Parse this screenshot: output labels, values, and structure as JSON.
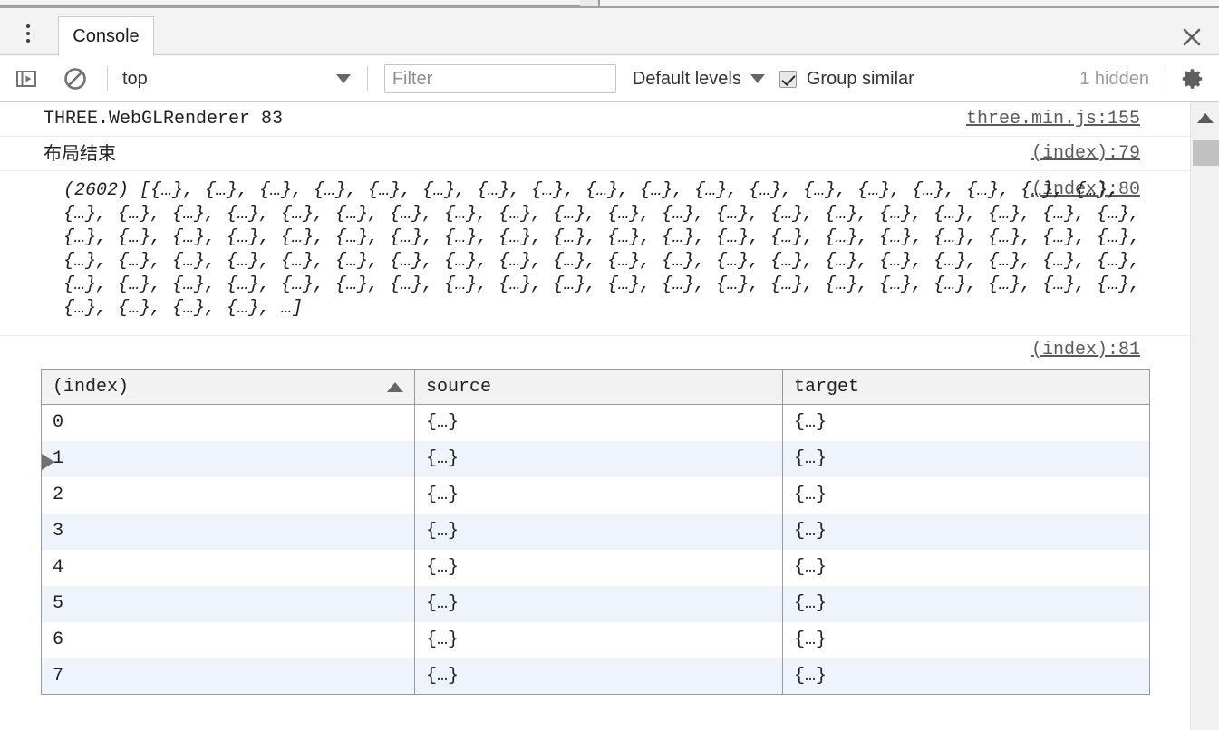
{
  "window": {
    "tabs": [
      {
        "label": "Console",
        "active": true
      }
    ],
    "more_tabs_icon": "kebab-menu-icon",
    "close_icon": "close-icon"
  },
  "toolbar": {
    "sidebar_toggle_icon": "show-console-sidebar-icon",
    "clear_console_icon": "clear-console-icon",
    "context": {
      "label": "top",
      "caret_icon": "chevron-down-icon"
    },
    "filter": {
      "placeholder": "Filter",
      "value": ""
    },
    "levels": {
      "label": "Default levels",
      "caret_icon": "chevron-down-icon"
    },
    "group_similar": {
      "label": "Group similar",
      "checked": true
    },
    "hidden_count": "1 hidden",
    "settings_icon": "gear-icon"
  },
  "messages": [
    {
      "text": "THREE.WebGLRenderer 83",
      "source": "three.min.js:155"
    },
    {
      "text": "布局结束",
      "source": "(index):79"
    }
  ],
  "array_message": {
    "disclosure_icon": "expand-triangle-icon",
    "source": "(index):80",
    "preview": "(2602) [{…}, {…}, {…}, {…}, {…}, {…}, {…}, {…}, {…}, {…}, {…}, {…}, {…}, {…}, {…}, {…}, {…}, {…}, {…}, {…}, {…}, {…}, {…}, {…}, {…}, {…}, {…}, {…}, {…}, {…}, {…}, {…}, {…}, {…}, {…}, {…}, {…}, {…}, {…}, {…}, {…}, {…}, {…}, {…}, {…}, {…}, {…}, {…}, {…}, {…}, {…}, {…}, {…}, {…}, {…}, {…}, {…}, {…}, {…}, {…}, {…}, {…}, {…}, {…}, {…}, {…}, {…}, {…}, {…}, {…}, {…}, {…}, {…}, {…}, {…}, {…}, {…}, {…}, {…}, {…}, {…}, {…}, {…}, {…}, {…}, {…}, {…}, {…}, {…}, {…}, {…}, {…}, {…}, {…}, {…}, {…}, {…}, {…}, {…}, {…}, {…}, {…}, …]",
    "length": 2602
  },
  "table_message": {
    "source": "(index):81",
    "columns": [
      {
        "label": "(index)",
        "sorted": "asc",
        "sort_icon": "sort-ascending-icon"
      },
      {
        "label": "source",
        "sorted": "none"
      },
      {
        "label": "target",
        "sorted": "none"
      }
    ],
    "rows": [
      {
        "index": "0",
        "source": "{…}",
        "target": "{…}"
      },
      {
        "index": "1",
        "source": "{…}",
        "target": "{…}"
      },
      {
        "index": "2",
        "source": "{…}",
        "target": "{…}"
      },
      {
        "index": "3",
        "source": "{…}",
        "target": "{…}"
      },
      {
        "index": "4",
        "source": "{…}",
        "target": "{…}"
      },
      {
        "index": "5",
        "source": "{…}",
        "target": "{…}"
      },
      {
        "index": "6",
        "source": "{…}",
        "target": "{…}"
      },
      {
        "index": "7",
        "source": "{…}",
        "target": "{…}"
      }
    ]
  },
  "scrollbar": {
    "up_arrow_icon": "scroll-up-arrow-icon"
  },
  "colors": {
    "toolbar_bg": "#f3f3f3",
    "panel_bg": "#ffffff",
    "link": "#5a5a5a",
    "row_alt": "#eff4fc",
    "table_border": "#9a9a9a",
    "muted_text": "#9c9c9c"
  }
}
